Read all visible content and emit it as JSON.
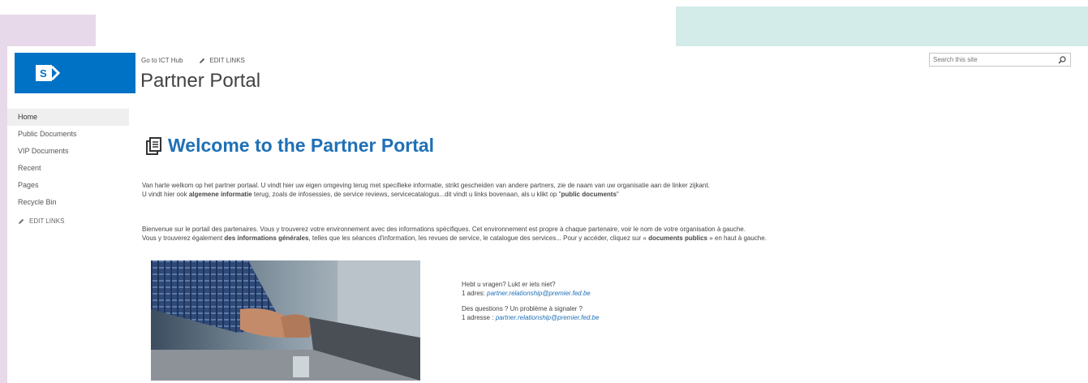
{
  "nav": {
    "hub_link": "Go to ICT Hub",
    "edit_links": "EDIT LINKS"
  },
  "site": {
    "title": "Partner Portal"
  },
  "search": {
    "placeholder": "Search this site"
  },
  "quicklaunch": {
    "items": [
      {
        "label": "Home"
      },
      {
        "label": "Public Documents"
      },
      {
        "label": "VIP Documents"
      },
      {
        "label": "Recent"
      },
      {
        "label": "Pages"
      },
      {
        "label": "Recycle Bin"
      }
    ],
    "edit_links": "EDIT LINKS"
  },
  "content": {
    "heading": "Welcome to the Partner Portal",
    "nl": {
      "line1": "Van harte welkom op het partner portaal. U vindt hier uw eigen omgeving terug met specifieke informatie, strikt gescheiden van andere partners, zie de naam van uw organisatie aan de linker zijkant.",
      "line2_a": "U vindt hier ook ",
      "line2_b": "algemene informatie",
      "line2_c": " terug, zoals de infosessies, de service reviews, servicecatalogus...dit vindt u links bovenaan, als u klikt op \"",
      "line2_d": "public documents",
      "line2_e": "\""
    },
    "fr": {
      "line1": "Bienvenue sur le portail des partenaires. Vous y trouverez votre environnement avec des informations spécifiques. Cet environnement est propre à chaque partenaire, voir le nom de votre organisation à gauche.",
      "line2_a": "Vous y trouverez également ",
      "line2_b": "des informations générales",
      "line2_c": ", telles que les séances d'information, les revues de service, le catalogue des services... Pour y accéder, cliquez sur « ",
      "line2_d": "documents publics",
      "line2_e": " » en haut à gauche."
    },
    "contact_nl": {
      "question": "Hebt u vragen? Lukt er iets niet?",
      "label": "1 adres: ",
      "email": "partner.relationship@premier.fed.be"
    },
    "contact_fr": {
      "question": "Des questions ? Un problème à signaler ?",
      "label": "1 adresse : ",
      "email": "partner.relationship@premier.fed.be"
    }
  },
  "colors": {
    "brand": "#0072c6",
    "heading": "#1f70b6",
    "deco_purple": "#e8d9ea",
    "deco_teal": "#d3ebe9"
  }
}
